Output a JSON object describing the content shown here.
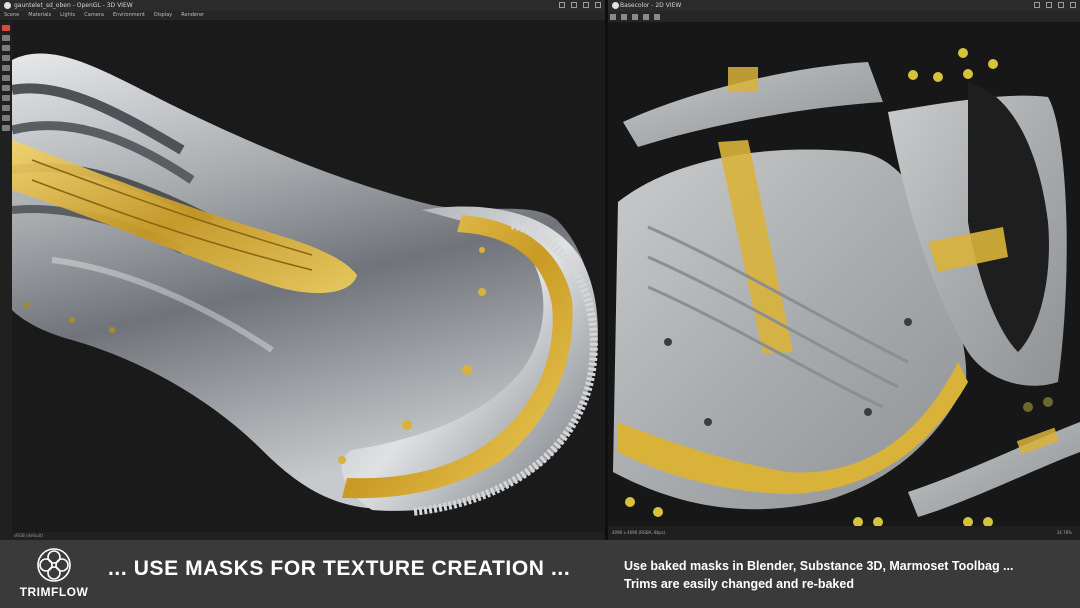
{
  "left_panel": {
    "title": "gauntelet_sd_oben - OpenGL - 3D VIEW",
    "menu": [
      "Scene",
      "Materials",
      "Lights",
      "Camera",
      "Environment",
      "Display",
      "Renderer"
    ],
    "status": "sRGB (default)"
  },
  "right_panel": {
    "title": "Basecolor - 2D VIEW",
    "status": "4096 x 4096 (RGBA, 8bpc)",
    "zoom": "34.78%"
  },
  "banner": {
    "logo_text": "TRIMFLOW",
    "headline": "... USE MASKS FOR TEXTURE CREATION ...",
    "line1": "Use baked masks in Blender, Substance 3D, Marmoset Toolbag ...",
    "line2": "Trims are easily changed and re-baked"
  },
  "colors": {
    "gold": "#d9b23a",
    "steel": "#b9bcbe",
    "background": "#1a1a1a",
    "banner": "#3a3a3a"
  }
}
